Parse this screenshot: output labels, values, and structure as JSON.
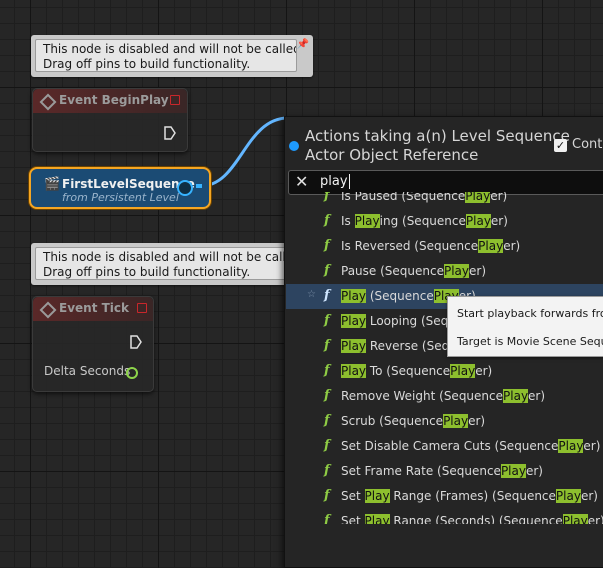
{
  "comments": [
    {
      "lines": [
        "This node is disabled and will not be called.",
        "Drag off pins to build functionality."
      ]
    },
    {
      "lines": [
        "This node is disabled and will not be called.",
        "Drag off pins to build functionality."
      ]
    }
  ],
  "nodes": {
    "begin_play": {
      "title": "Event BeginPlay"
    },
    "tick": {
      "title": "Event Tick",
      "pin_label": "Delta Seconds"
    },
    "variable": {
      "title": "FirstLevelSequence",
      "subtitle": "from Persistent Level"
    }
  },
  "action_menu": {
    "title_line1": "Actions taking a(n) Level Sequence",
    "title_line2": "Actor Object Reference",
    "context_label": "Conte",
    "search_value": "play",
    "items": [
      {
        "parts": [
          {
            "t": "Is Paused (Sequence"
          },
          {
            "t": "Play",
            "h": true
          },
          {
            "t": "er)"
          }
        ]
      },
      {
        "parts": [
          {
            "t": "Is "
          },
          {
            "t": "Play",
            "h": true
          },
          {
            "t": "ing (Sequence"
          },
          {
            "t": "Play",
            "h": true
          },
          {
            "t": "er)"
          }
        ]
      },
      {
        "parts": [
          {
            "t": "Is Reversed (Sequence"
          },
          {
            "t": "Play",
            "h": true
          },
          {
            "t": "er)"
          }
        ]
      },
      {
        "parts": [
          {
            "t": "Pause (Sequence"
          },
          {
            "t": "Play",
            "h": true
          },
          {
            "t": "er)"
          }
        ]
      },
      {
        "selected": true,
        "parts": [
          {
            "t": "Play",
            "h": true
          },
          {
            "t": " (Sequence"
          },
          {
            "t": "Play",
            "h": true
          },
          {
            "t": "er)"
          }
        ]
      },
      {
        "parts": [
          {
            "t": "Play",
            "h": true
          },
          {
            "t": " Looping (Sequence"
          },
          {
            "t": "Play",
            "h": true
          },
          {
            "t": "er)"
          }
        ]
      },
      {
        "parts": [
          {
            "t": "Play",
            "h": true
          },
          {
            "t": " Reverse (Sequence"
          },
          {
            "t": "Play",
            "h": true
          },
          {
            "t": "er)"
          }
        ]
      },
      {
        "parts": [
          {
            "t": "Play",
            "h": true
          },
          {
            "t": " To (Sequence"
          },
          {
            "t": "Play",
            "h": true
          },
          {
            "t": "er)"
          }
        ]
      },
      {
        "parts": [
          {
            "t": "Remove Weight (Sequence"
          },
          {
            "t": "Play",
            "h": true
          },
          {
            "t": "er)"
          }
        ]
      },
      {
        "parts": [
          {
            "t": "Scrub (Sequence"
          },
          {
            "t": "Play",
            "h": true
          },
          {
            "t": "er)"
          }
        ]
      },
      {
        "parts": [
          {
            "t": "Set Disable Camera Cuts (Sequence"
          },
          {
            "t": "Play",
            "h": true
          },
          {
            "t": "er)"
          }
        ]
      },
      {
        "parts": [
          {
            "t": "Set Frame Rate (Sequence"
          },
          {
            "t": "Play",
            "h": true
          },
          {
            "t": "er)"
          }
        ]
      },
      {
        "parts": [
          {
            "t": "Set "
          },
          {
            "t": "Play",
            "h": true
          },
          {
            "t": " Range (Frames) (Sequence"
          },
          {
            "t": "Play",
            "h": true
          },
          {
            "t": "er)"
          }
        ]
      },
      {
        "parts": [
          {
            "t": "Set "
          },
          {
            "t": "Play",
            "h": true
          },
          {
            "t": " Range (Seconds) (Sequence"
          },
          {
            "t": "Play",
            "h": true
          },
          {
            "t": "er)"
          }
        ]
      }
    ]
  },
  "tooltip": {
    "line1": "Start playback forwards fro",
    "line2": "Target is Movie Scene Sequ"
  },
  "colors": {
    "accent": "#1e9bff",
    "highlight": "#8dbf2e",
    "selection": "#f5a623"
  }
}
